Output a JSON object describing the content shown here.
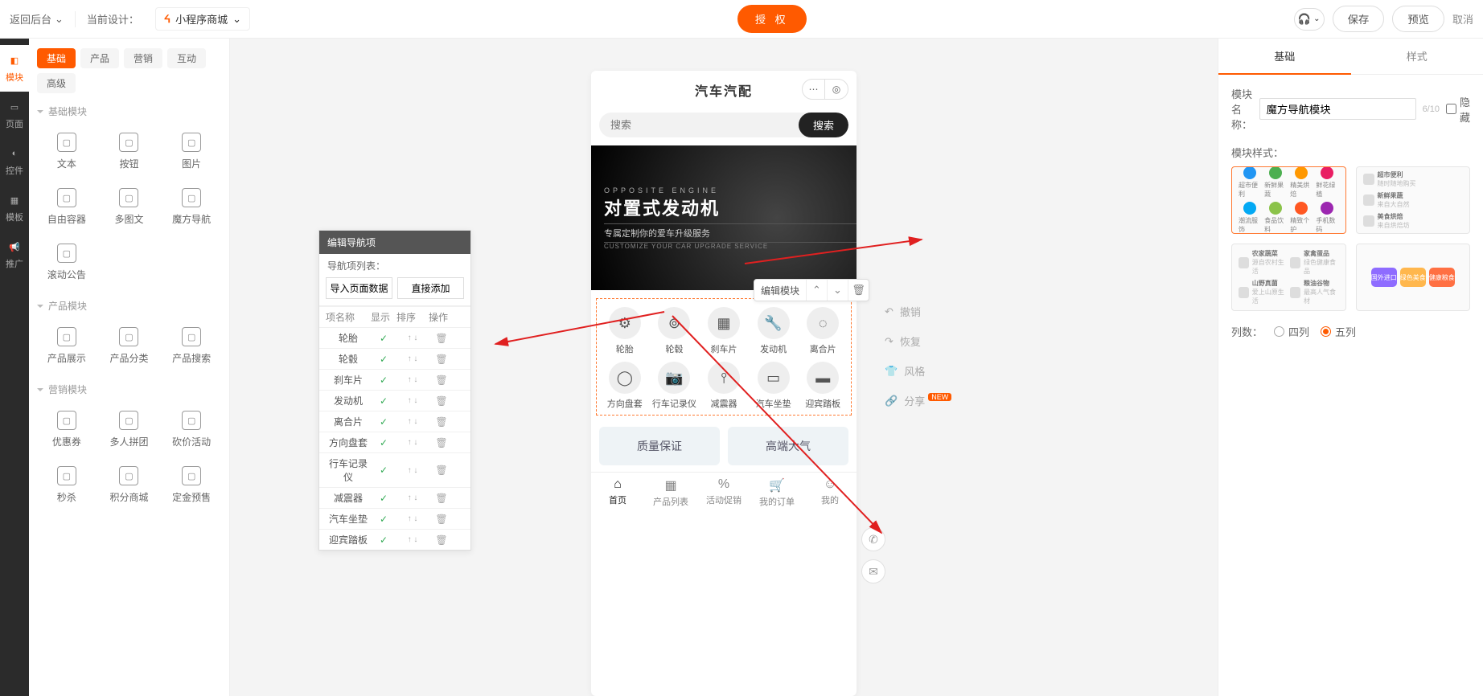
{
  "topbar": {
    "back": "返回后台",
    "current_design_label": "当前设计：",
    "design_name": "小程序商城",
    "auth_btn": "授 权",
    "save": "保存",
    "preview": "预览",
    "cancel": "取消"
  },
  "rail": [
    {
      "label": "模块",
      "active": true
    },
    {
      "label": "页面"
    },
    {
      "label": "控件"
    },
    {
      "label": "模板"
    },
    {
      "label": "推广"
    }
  ],
  "palette": {
    "tabs": [
      "基础",
      "产品",
      "营销",
      "互动",
      "高级"
    ],
    "active_tab": 0,
    "sections": [
      {
        "title": "基础模块",
        "items": [
          "文本",
          "按钮",
          "图片",
          "自由容器",
          "多图文",
          "魔方导航",
          "滚动公告"
        ]
      },
      {
        "title": "产品模块",
        "items": [
          "产品展示",
          "产品分类",
          "产品搜索"
        ]
      },
      {
        "title": "营销模块",
        "items": [
          "优惠券",
          "多人拼团",
          "砍价活动",
          "秒杀",
          "积分商城",
          "定金预售"
        ]
      }
    ]
  },
  "editnav": {
    "title": "编辑导航项",
    "list_label": "导航项列表：",
    "btn_import": "导入页面数据",
    "btn_add": "直接添加",
    "cols": {
      "name": "项名称",
      "show": "显示",
      "sort": "排序",
      "op": "操作"
    },
    "rows": [
      "轮胎",
      "轮毂",
      "刹车片",
      "发动机",
      "离合片",
      "方向盘套",
      "行车记录仪",
      "减震器",
      "汽车坐垫",
      "迎宾踏板"
    ]
  },
  "phone": {
    "title": "汽车汽配",
    "search_placeholder": "搜索",
    "search_btn": "搜索",
    "banner": {
      "sup": "OPPOSITE ENGINE",
      "main": "对置式发动机",
      "sub": "专属定制你的爱车升级服务",
      "en": "CUSTOMIZE YOUR CAR UPGRADE SERVICE"
    },
    "edit_module": "编辑模块",
    "nav_items": [
      "轮胎",
      "轮毂",
      "刹车片",
      "发动机",
      "离合片",
      "方向盘套",
      "行车记录仪",
      "减震器",
      "汽车坐垫",
      "迎宾踏板"
    ],
    "feat1": "质量保证",
    "feat2": "高端大气",
    "tabbar": [
      "首页",
      "产品列表",
      "活动促销",
      "我的订单",
      "我的"
    ]
  },
  "canvas_tools": {
    "undo": "撤销",
    "redo": "恢复",
    "style": "风格",
    "share": "分享",
    "new_badge": "NEW"
  },
  "prop": {
    "tabs": [
      "基础",
      "样式"
    ],
    "active_tab": 0,
    "name_label": "模块名称：",
    "name_value": "魔方导航模块",
    "name_counter": "6/10",
    "hide_label": "隐藏",
    "style_label": "模块样式：",
    "style_cards": {
      "a_icons": [
        "超市便利",
        "新鲜果蔬",
        "精美烘焙",
        "鲜花绿植",
        "潮流服饰",
        "食品饮料",
        "精致个护",
        "手机数码"
      ],
      "b_list": [
        {
          "t": "超市便利",
          "s": "随时随地购买"
        },
        {
          "t": "新鲜果蔬",
          "s": "来自大自然"
        },
        {
          "t": "美食烘焙",
          "s": "来自烘焙坊"
        }
      ],
      "c_list": [
        {
          "t": "农家蔬菜",
          "s": "源自农村生活"
        },
        {
          "t": "家禽蛋品",
          "s": "绿色健康食品"
        },
        {
          "t": "山野真菌",
          "s": "爱上山原生活"
        },
        {
          "t": "粮油谷物",
          "s": "最高人气食材"
        }
      ],
      "d_pills": [
        "国外进口",
        "绿色美食",
        "健康粮食"
      ]
    },
    "cols_label": "列数：",
    "cols_options": [
      "四列",
      "五列"
    ],
    "cols_selected": 1
  }
}
